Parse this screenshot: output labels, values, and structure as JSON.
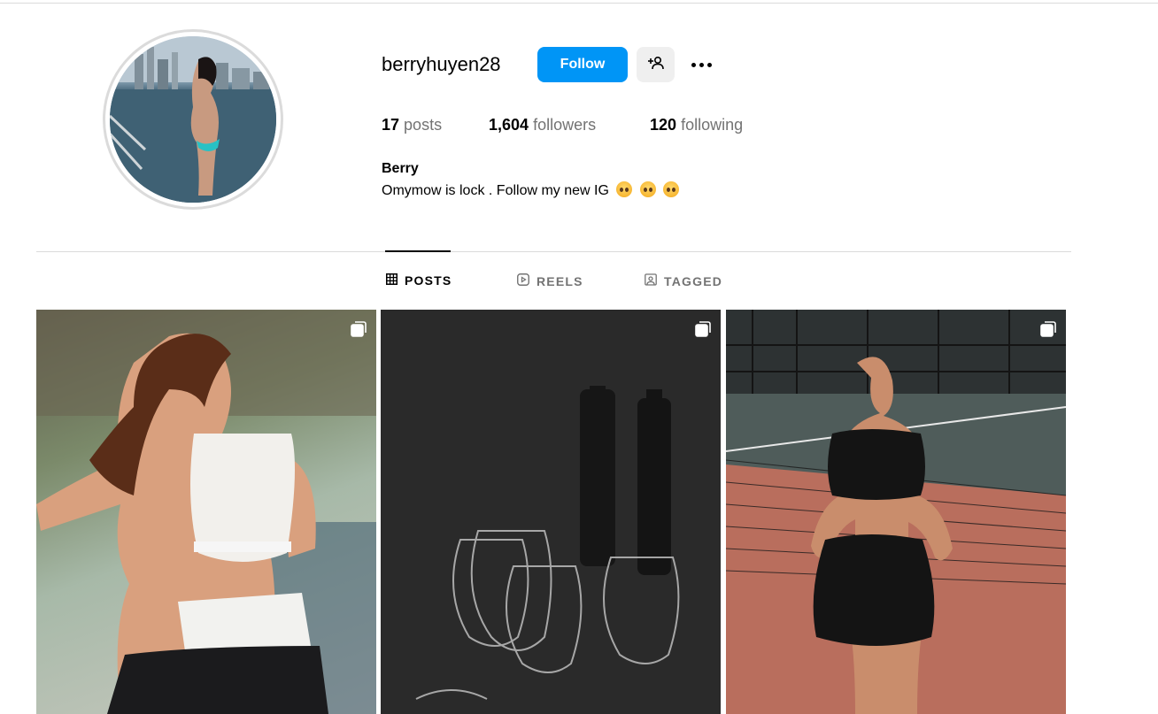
{
  "profile": {
    "username": "berryhuyen28",
    "follow_label": "Follow",
    "display_name": "Berry",
    "bio_text": "Omymow is lock . Follow my new IG",
    "bio_emojis": [
      "pleading-face",
      "pleading-face",
      "pleading-face"
    ],
    "stats": {
      "posts_count": "17",
      "posts_label": "posts",
      "followers_count": "1,604",
      "followers_label": "followers",
      "following_count": "120",
      "following_label": "following"
    }
  },
  "tabs": [
    {
      "label": "POSTS",
      "icon": "grid-icon",
      "active": true
    },
    {
      "label": "REELS",
      "icon": "reels-icon",
      "active": false
    },
    {
      "label": "TAGGED",
      "icon": "tagged-icon",
      "active": false
    }
  ],
  "posts": [
    {
      "type": "carousel",
      "icon": "multiple-posts-icon"
    },
    {
      "type": "carousel",
      "icon": "multiple-posts-icon"
    },
    {
      "type": "carousel",
      "icon": "multiple-posts-icon"
    }
  ],
  "colors": {
    "accent": "#0095f6",
    "secondary_button": "#efefef",
    "muted_text": "#737373",
    "divider": "#dbdbdb"
  }
}
